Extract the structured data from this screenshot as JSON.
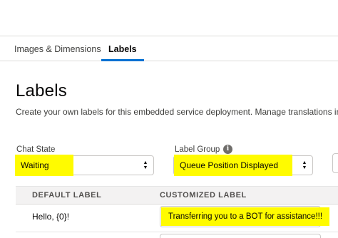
{
  "tabs": [
    {
      "label": "Images & Dimensions",
      "active": false
    },
    {
      "label": "Labels",
      "active": true
    }
  ],
  "page": {
    "title": "Labels",
    "description": "Create your own labels for this embedded service deployment. Manage translations in each"
  },
  "filters": {
    "chat_state": {
      "label": "Chat State",
      "value": "Waiting"
    },
    "label_group": {
      "label": "Label Group",
      "value": "Queue Position Displayed",
      "info_icon": "info-icon"
    }
  },
  "table": {
    "columns": [
      "DEFAULT LABEL",
      "CUSTOMIZED LABEL"
    ],
    "rows": [
      {
        "default": "Hello, {0}!",
        "custom": "Transferring you to a BOT for assistance!!!"
      }
    ]
  },
  "colors": {
    "accent": "#0070d2",
    "highlight": "#fffb00",
    "header_bg": "#f3f2f2"
  }
}
